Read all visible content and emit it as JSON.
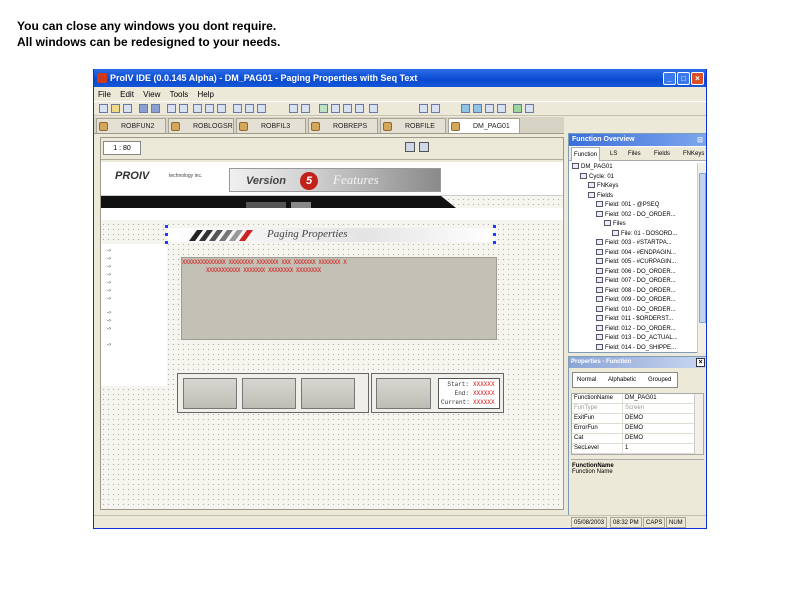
{
  "caption": {
    "line1": "You can close any windows you dont require.",
    "line2": "All windows can be redesigned to your needs."
  },
  "window": {
    "title": "ProIV IDE (0.0.145 Alpha) - DM_PAG01 - Paging Properties with Seq Text",
    "minimize_glyph": "_",
    "maximize_glyph": "□",
    "close_glyph": "×"
  },
  "menu": {
    "items": [
      "File",
      "Edit",
      "View",
      "Tools",
      "Help"
    ]
  },
  "tabs": [
    {
      "label": "ROBFUN2"
    },
    {
      "label": "ROBLOGSR"
    },
    {
      "label": "ROBFIL3"
    },
    {
      "label": "ROBREPS"
    },
    {
      "label": "ROBFILE"
    },
    {
      "label": "DM_PAG01"
    }
  ],
  "designer": {
    "page_indicator": "1 : 80",
    "banner": {
      "brand": "PROIV",
      "brand_sub": "technology inc.",
      "version_word": "Version",
      "version_number": "5",
      "features": "Features"
    },
    "heading": "Paging Properties",
    "row_markers": [
      "-›",
      "-›",
      "-›",
      "-›",
      "-›",
      "-›",
      "-›",
      "-›",
      "-›",
      "-›",
      "-›"
    ],
    "placeholders": {
      "row1": "XXXXXXXXXXXXXX  XXXXXXXX  XXXXXXX  XXX  XXXXXXX  XXXXXXX  X",
      "row2": "XXXXXXXXXXX  XXXXXXX  XXXXXXXX  XXXXXXXX"
    },
    "info": {
      "start_label": "Start:",
      "start_value": "XXXXXX",
      "end_label": "End:",
      "end_value": "XXXXXX",
      "current_label": "Current:",
      "current_value": "XXXXXX"
    }
  },
  "function_overview": {
    "title": "Function Overview",
    "pin": "⊡",
    "tabs": [
      "Function",
      "LS",
      "Files",
      "Fields",
      "FNKeys"
    ],
    "tree": [
      {
        "label": "DM_PAG01",
        "indent": 0
      },
      {
        "label": "Cycle: 01",
        "indent": 1
      },
      {
        "label": "FNKeys",
        "indent": 2
      },
      {
        "label": "Fields",
        "indent": 2
      },
      {
        "label": "Field: 001 - @PSEQ",
        "indent": 3
      },
      {
        "label": "Field: 002 - DO_ORDER...",
        "indent": 3
      },
      {
        "label": "Files",
        "indent": 4
      },
      {
        "label": "File: 01 - DOSORD...",
        "indent": 5
      },
      {
        "label": "Field: 003 - #STARTPA...",
        "indent": 3
      },
      {
        "label": "Field: 004 - #ENDPAGIN...",
        "indent": 3
      },
      {
        "label": "Field: 005 - #CURPAGIN...",
        "indent": 3
      },
      {
        "label": "Field: 006 - DO_ORDER...",
        "indent": 3
      },
      {
        "label": "Field: 007 - DO_ORDER...",
        "indent": 3
      },
      {
        "label": "Field: 008 - DO_ORDER...",
        "indent": 3
      },
      {
        "label": "Field: 009 - DO_ORDER...",
        "indent": 3
      },
      {
        "label": "Field: 010 - DO_ORDER...",
        "indent": 3
      },
      {
        "label": "Field: 011 - $ORDERST...",
        "indent": 3
      },
      {
        "label": "Field: 012 - DO_ORDER...",
        "indent": 3
      },
      {
        "label": "Field: 013 - DO_ACTUAL...",
        "indent": 3
      },
      {
        "label": "Field: 014 - DO_SHIPPE...",
        "indent": 3
      }
    ]
  },
  "properties": {
    "title": "Properties - Function",
    "close_glyph": "×",
    "tabs": [
      "Normal",
      "Alphabetic",
      "Grouped"
    ],
    "rows": [
      {
        "key": "FunctionName",
        "value": "DM_PAG01",
        "dim": false
      },
      {
        "key": "FunType",
        "value": "Screen",
        "dim": true
      },
      {
        "key": "ExitFun",
        "value": "DEMO",
        "dim": false
      },
      {
        "key": "ErrorFun",
        "value": "DEMO",
        "dim": false
      },
      {
        "key": "Cat",
        "value": "DEMO",
        "dim": false
      },
      {
        "key": "SecLevel",
        "value": "1",
        "dim": false
      }
    ],
    "description_title": "FunctionName",
    "description_text": "Function Name"
  },
  "status": {
    "date": "05/08/2003",
    "time": "08:32 PM",
    "caps": "CAPS",
    "num": "NUM"
  },
  "colors": {
    "title_bar": "#0a4ad0",
    "placeholder_red": "#d51414",
    "grid_fill": "#c3c1b6",
    "version_red": "#c2211b"
  }
}
